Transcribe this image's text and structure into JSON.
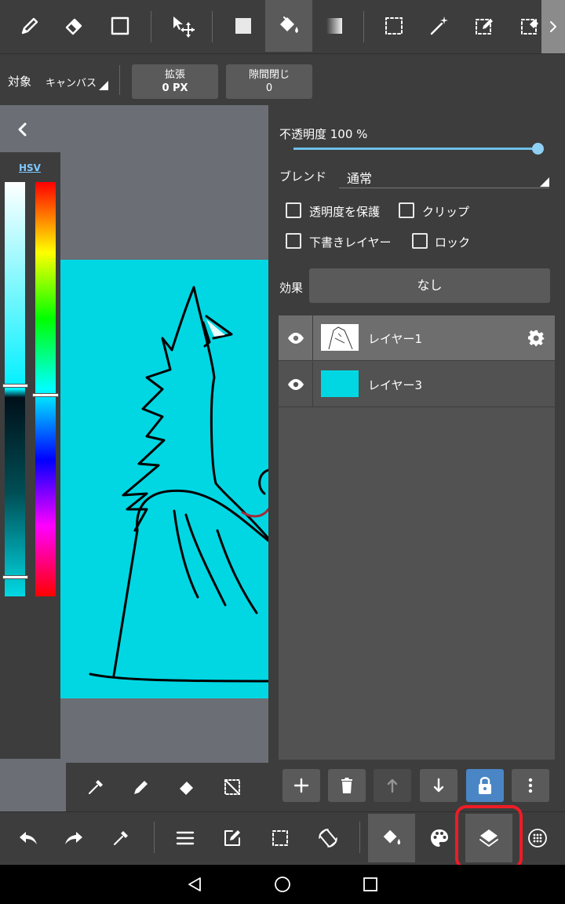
{
  "toolbar": {
    "tools": [
      {
        "icon": "pen-icon"
      },
      {
        "icon": "eraser-icon"
      },
      {
        "icon": "rectangle-icon"
      },
      {
        "icon": "move-icon"
      },
      {
        "icon": "fill-square-icon"
      },
      {
        "icon": "bucket-icon",
        "selected": true
      },
      {
        "icon": "gradient-icon"
      },
      {
        "icon": "select-rect-icon"
      },
      {
        "icon": "magic-wand-icon"
      },
      {
        "icon": "select-pen-icon"
      },
      {
        "icon": "select-eraser-icon"
      }
    ],
    "more_icon": "chevron-right-icon"
  },
  "options": {
    "target_label": "対象",
    "target_value": "キャンバス",
    "expand_label": "拡張",
    "expand_value": "0 PX",
    "gap_label": "隙間閉じ",
    "gap_value": "0"
  },
  "canvas": {
    "collapse_icon": "chevron-left-icon",
    "color_mode": "HSV",
    "artboard_color": "#00d7e3"
  },
  "layer_panel": {
    "opacity_label": "不透明度 100 %",
    "opacity": 100,
    "blend_label": "ブレンド",
    "blend_value": "通常",
    "checkboxes": {
      "protect_alpha": "透明度を保護",
      "clip": "クリップ",
      "draft": "下書きレイヤー",
      "lock": "ロック"
    },
    "effect_label": "効果",
    "effect_value": "なし",
    "layers": [
      {
        "name": "レイヤー1",
        "selected": true,
        "visible": true
      },
      {
        "name": "レイヤー3",
        "selected": false,
        "visible": true
      }
    ]
  },
  "layer_actions": [
    "add-icon",
    "trash-icon",
    "move-up-icon",
    "move-down-icon",
    "lock-icon",
    "more-vertical-icon"
  ],
  "brush_bar": [
    "eyedropper-icon",
    "pen-icon",
    "eraser-icon",
    "deselect-icon"
  ],
  "bottom_bar": [
    "undo-icon",
    "redo-icon",
    "eyedropper-icon",
    "menu-icon",
    "edit-icon",
    "selection-icon",
    "rotate-icon",
    "bucket-icon",
    "palette-icon",
    "layers-icon",
    "brush-grid-icon"
  ],
  "colors": {
    "panel": "#3d3d3d",
    "button": "#5a5a5a",
    "accent": "#7ec8ff",
    "highlight": "#ee1c25"
  }
}
